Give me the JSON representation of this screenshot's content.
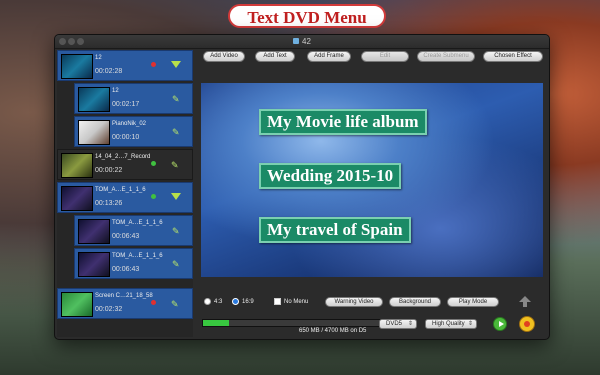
{
  "banner": "Text DVD Menu",
  "window": {
    "title": "42"
  },
  "sidebar": {
    "items": [
      {
        "name": "12",
        "time": "00:02:28"
      },
      {
        "name": "12",
        "time": "00:02:17"
      },
      {
        "name": "PianoNik_02",
        "time": "00:00:10"
      },
      {
        "name": "14_04_2…7_Record",
        "time": "00:00:22"
      },
      {
        "name": "TOM_A…E_1_1_6",
        "time": "00:13:26"
      },
      {
        "name": "TOM_A…E_1_1_6",
        "time": "00:06:43"
      },
      {
        "name": "TOM_A…E_1_1_6",
        "time": "00:06:43"
      },
      {
        "name": "Screen C…21_18_58",
        "time": "00:02:32"
      }
    ]
  },
  "toolbar": {
    "add_video": "Add Video",
    "add_text": "Add Text",
    "add_frame": "Add Frame",
    "edit": "Edit",
    "create_submenu": "Create Submenu",
    "chosen_effect": "Chosen Effect"
  },
  "menu": {
    "items": [
      "My Movie life album",
      "Wedding 2015-10",
      "My travel of Spain"
    ]
  },
  "options": {
    "ratio_43": "4:3",
    "ratio_169": "16:9",
    "no_menu": "No Menu",
    "warning_video": "Warning Video",
    "background": "Background",
    "play_mode": "Play Mode"
  },
  "status": {
    "size_text": "650 MB / 4700 MB on D5",
    "progress_fraction": 0.14,
    "disc": "DVD5",
    "quality": "High Quality"
  }
}
